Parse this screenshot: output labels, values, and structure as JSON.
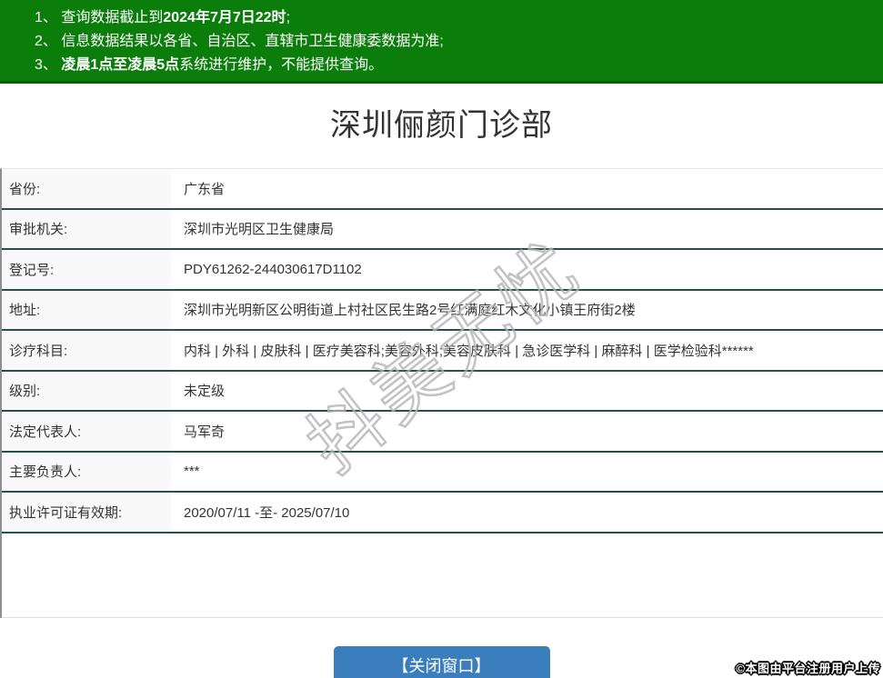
{
  "notices": [
    {
      "normal1": "1、 查询数据截止到",
      "bold": "2024年7月7日22时",
      "normal2": ";"
    },
    {
      "normal1": "2、 信息数据结果以各省、自治区、直辖市卫生健康委数据为准;",
      "bold": "",
      "normal2": ""
    },
    {
      "normal1": "3、 ",
      "bold": "凌晨1点至凌晨5点",
      "normal2": "系统进行维护，不能提供查询。"
    }
  ],
  "title": "深圳俪颜门诊部",
  "table": {
    "rows": [
      {
        "label": "省份:",
        "value": "广东省"
      },
      {
        "label": "审批机关:",
        "value": "深圳市光明区卫生健康局"
      },
      {
        "label": "登记号:",
        "value": "PDY61262-244030617D1102"
      },
      {
        "label": "地址:",
        "value": "深圳市光明新区公明街道上村社区民生路2号红满庭红木文化小镇王府街2楼"
      },
      {
        "label": "诊疗科目:",
        "value": "内科 | 外科 | 皮肤科 | 医疗美容科;美容外科;美容皮肤科 | 急诊医学科 | 麻醉科 | 医学检验科******"
      },
      {
        "label": "级别:",
        "value": "未定级"
      },
      {
        "label": "法定代表人:",
        "value": "马军奇"
      },
      {
        "label": "主要负责人:",
        "value": "***"
      },
      {
        "label": "执业许可证有效期:",
        "value": "2020/07/11 -至- 2025/07/10"
      }
    ]
  },
  "watermark": "抖美无忧",
  "close_button_label": "【关闭窗口】",
  "attribution": "©本图由平台注册用户上传",
  "colors": {
    "green": "#0b7d0b",
    "green_dark": "#056105",
    "row_border": "#26504a",
    "button_blue": "#3a7ebd",
    "label_bg": "#f9f9f9",
    "text": "#333333"
  }
}
